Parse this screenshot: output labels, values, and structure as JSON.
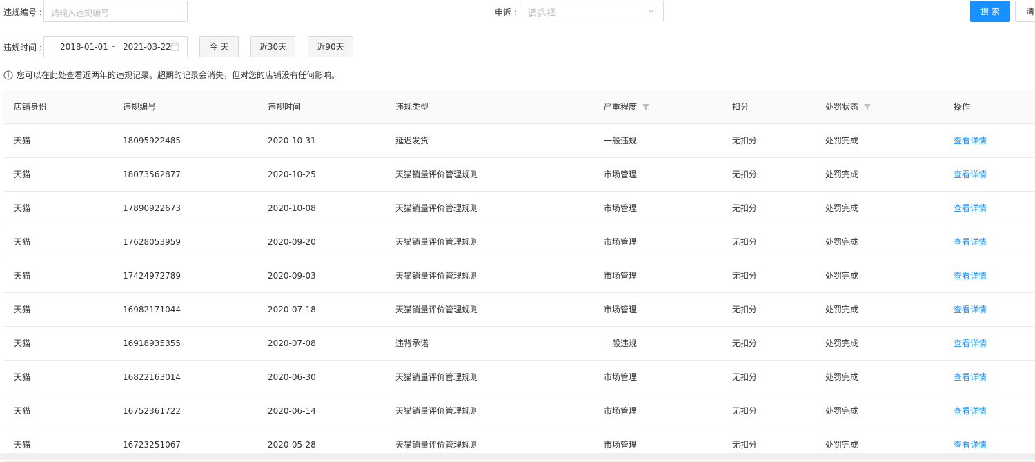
{
  "filters": {
    "violation_no_label": "违规编号 :",
    "violation_no_placeholder": "请输入违规编号",
    "appeal_label": "申诉 :",
    "appeal_placeholder": "请选择",
    "search_button": "搜 索",
    "clear_button": "清",
    "time_label": "违规时间 :",
    "date_start": "2018-01-01",
    "date_sep": "~",
    "date_end": "2021-03-22",
    "today_button": "今 天",
    "last30_button": "近30天",
    "last90_button": "近90天"
  },
  "notice": "您可以在此处查看近两年的违规记录。超期的记录会消失，但对您的店铺没有任何影响。",
  "table": {
    "columns": [
      "店铺身份",
      "违规编号",
      "违规时间",
      "违规类型",
      "严重程度",
      "扣分",
      "处罚状态",
      "操作"
    ],
    "rows": [
      [
        "天猫",
        "18095922485",
        "2020-10-31",
        "延迟发货",
        "一般违规",
        "无扣分",
        "处罚完成",
        "查看详情"
      ],
      [
        "天猫",
        "18073562877",
        "2020-10-25",
        "天猫销量评价管理规则",
        "市场管理",
        "无扣分",
        "处罚完成",
        "查看详情"
      ],
      [
        "天猫",
        "17890922673",
        "2020-10-08",
        "天猫销量评价管理规则",
        "市场管理",
        "无扣分",
        "处罚完成",
        "查看详情"
      ],
      [
        "天猫",
        "17628053959",
        "2020-09-20",
        "天猫销量评价管理规则",
        "市场管理",
        "无扣分",
        "处罚完成",
        "查看详情"
      ],
      [
        "天猫",
        "17424972789",
        "2020-09-03",
        "天猫销量评价管理规则",
        "市场管理",
        "无扣分",
        "处罚完成",
        "查看详情"
      ],
      [
        "天猫",
        "16982171044",
        "2020-07-18",
        "天猫销量评价管理规则",
        "市场管理",
        "无扣分",
        "处罚完成",
        "查看详情"
      ],
      [
        "天猫",
        "16918935355",
        "2020-07-08",
        "违背承诺",
        "一般违规",
        "无扣分",
        "处罚完成",
        "查看详情"
      ],
      [
        "天猫",
        "16822163014",
        "2020-06-30",
        "天猫销量评价管理规则",
        "市场管理",
        "无扣分",
        "处罚完成",
        "查看详情"
      ],
      [
        "天猫",
        "16752361722",
        "2020-06-14",
        "天猫销量评价管理规则",
        "市场管理",
        "无扣分",
        "处罚完成",
        "查看详情"
      ],
      [
        "天猫",
        "16723251067",
        "2020-05-28",
        "天猫销量评价管理规则",
        "市场管理",
        "无扣分",
        "处罚完成",
        "查看详情"
      ]
    ]
  },
  "colors": {
    "accent": "#1890ff",
    "header_bg": "#fafafa",
    "border": "#e8e8e8"
  },
  "icons": {
    "info": "info-circle-icon",
    "calendar": "calendar-icon",
    "select": "chevron-down-icon",
    "filter": "filter-icon"
  }
}
